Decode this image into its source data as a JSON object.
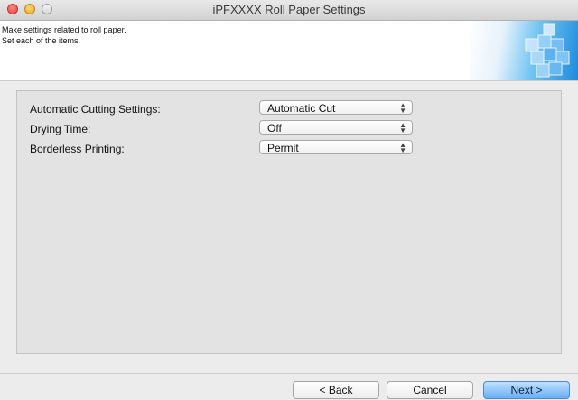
{
  "window": {
    "title": "iPFXXXX Roll Paper Settings"
  },
  "header": {
    "line1": "Make settings related to roll paper.",
    "line2": "Set each of the items.",
    "logo_icon": "printer-cubes-icon"
  },
  "settings": [
    {
      "label": "Automatic Cutting Settings:",
      "value": "Automatic Cut"
    },
    {
      "label": "Drying Time:",
      "value": "Off"
    },
    {
      "label": "Borderless Printing:",
      "value": "Permit"
    }
  ],
  "footer": {
    "back_label": "< Back",
    "cancel_label": "Cancel",
    "next_label": "Next >"
  },
  "colors": {
    "accent": "#6aaef5",
    "logo_blue": "#1e8bdd"
  }
}
